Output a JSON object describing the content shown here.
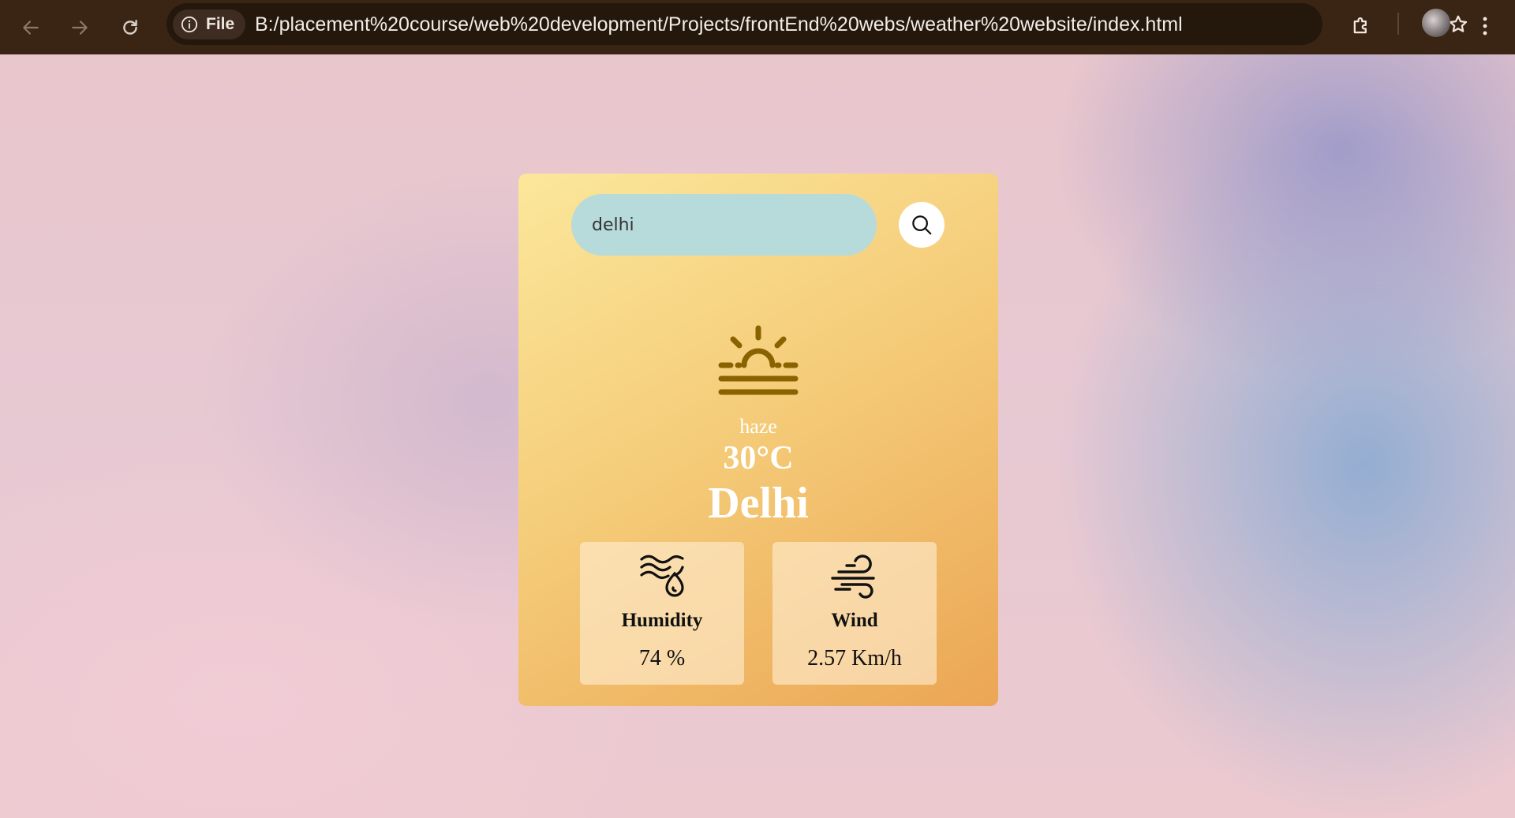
{
  "browser": {
    "site_chip_label": "File",
    "url": "B:/placement%20course/web%20development/Projects/frontEnd%20webs/weather%20website/index.html"
  },
  "weather": {
    "search_value": "delhi",
    "condition": "haze",
    "temperature": "30°C",
    "city": "Delhi",
    "humidity_label": "Humidity",
    "humidity_value": "74 %",
    "wind_label": "Wind",
    "wind_value": "2.57 Km/h"
  },
  "icons": {
    "main_weather": "haze-icon",
    "humidity": "humidity-icon",
    "wind": "wind-icon",
    "search": "search-icon"
  },
  "colors": {
    "card_gradient_start": "#fbe79b",
    "card_gradient_end": "#eba654",
    "search_field_bg": "#b7dadb",
    "icon_color": "#8a6300"
  }
}
